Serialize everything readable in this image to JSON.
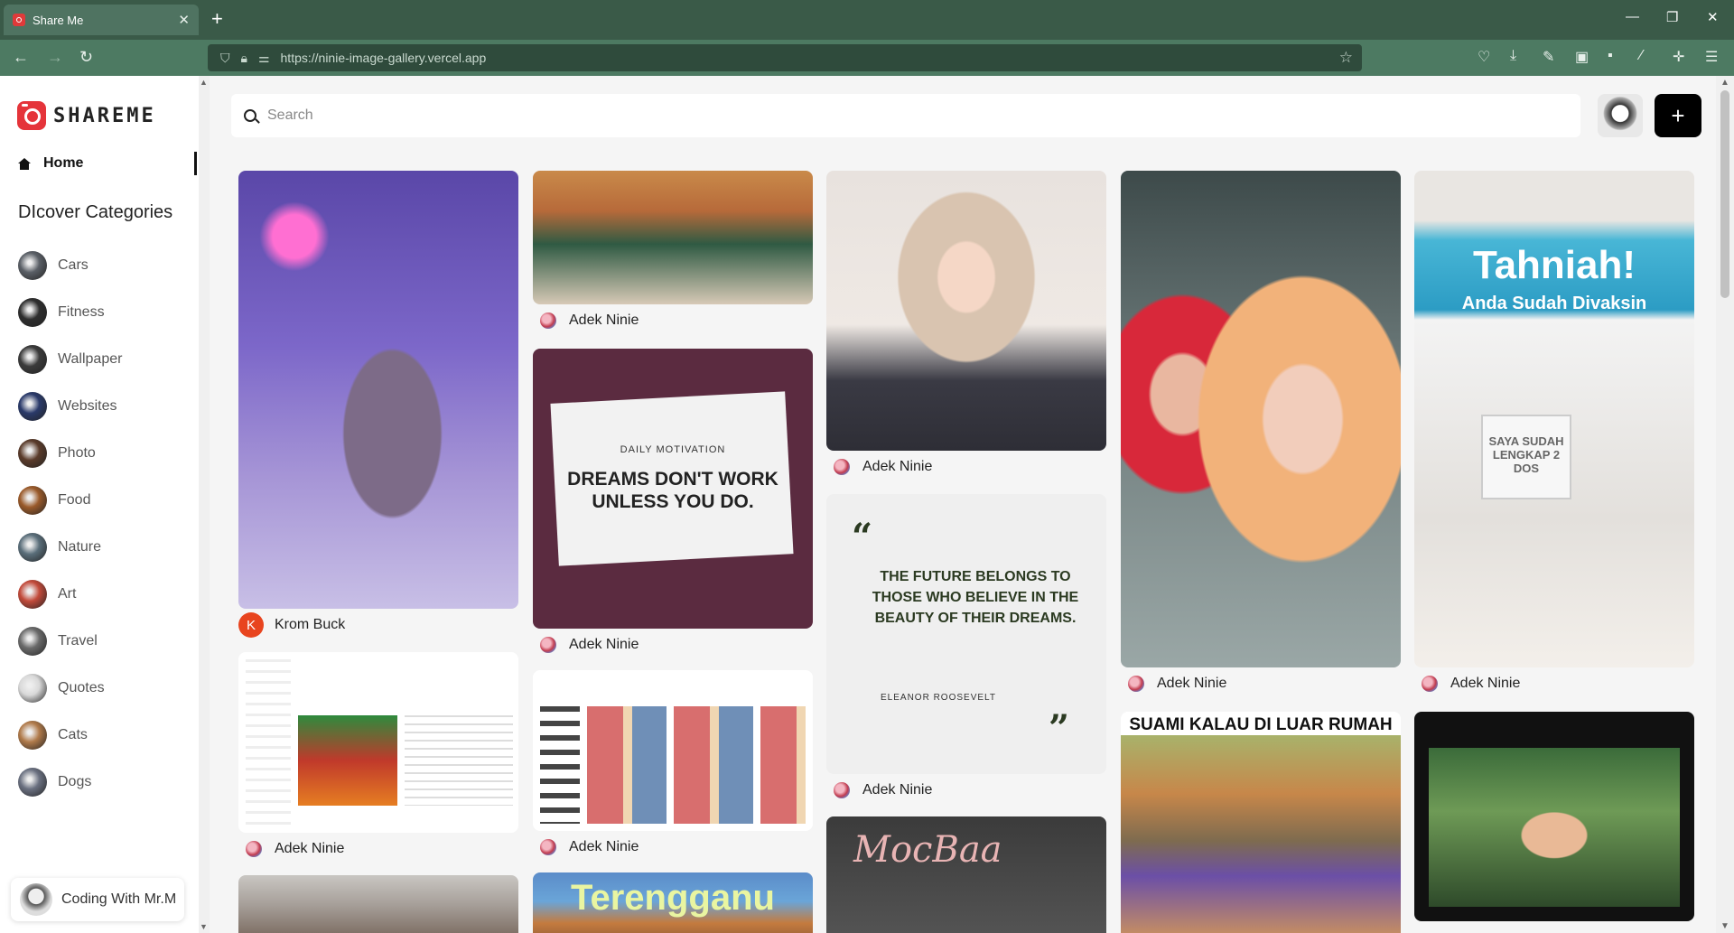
{
  "browser": {
    "tab_title": "Share Me",
    "url": "https://ninie-image-gallery.vercel.app"
  },
  "app": {
    "logo_text": "SHAREME",
    "home_label": "Home",
    "categories_title": "DIcover Categories",
    "categories": [
      {
        "name": "Cars",
        "color": "#5a5f66"
      },
      {
        "name": "Fitness",
        "color": "#2e2e2e"
      },
      {
        "name": "Wallpaper",
        "color": "#3a3a3a"
      },
      {
        "name": "Websites",
        "color": "#2a3a6a"
      },
      {
        "name": "Photo",
        "color": "#5a3b2a"
      },
      {
        "name": "Food",
        "color": "#9a5a2a"
      },
      {
        "name": "Nature",
        "color": "#5a6e7a"
      },
      {
        "name": "Art",
        "color": "#c24a3a"
      },
      {
        "name": "Travel",
        "color": "#6a6a6a"
      },
      {
        "name": "Quotes",
        "color": "#d9d9d9"
      },
      {
        "name": "Cats",
        "color": "#b07a4a"
      },
      {
        "name": "Dogs",
        "color": "#6a7080"
      }
    ],
    "profile_name": "Coding With Mr.M",
    "search_placeholder": "Search",
    "add_button": "+",
    "accent_color": "#e5343a"
  },
  "pins": [
    {
      "author": "Krom Buck",
      "avatar_letter": "K"
    },
    {
      "author": "Adek Ninie"
    },
    {
      "author": "Adek Ninie"
    },
    {
      "author": "Adek Ninie"
    },
    {
      "author": "Adek Ninie"
    },
    {
      "author": "Adek Ninie"
    },
    {
      "author": "Adek Ninie"
    },
    {
      "author": "Adek Ninie"
    },
    {
      "author": "Adek Ninie"
    }
  ],
  "pin_text": {
    "daily_motivation": "DAILY MOTIVATION",
    "dreams_quote": "DREAMS DON'T WORK UNLESS YOU DO.",
    "future_quote": "THE FUTURE BELONGS TO THOSE WHO BELIEVE IN THE BEAUTY OF THEIR DREAMS.",
    "future_author": "ELEANOR ROOSEVELT",
    "tahniah_title": "Tahniah!",
    "tahniah_sub": "Anda Sudah Divaksin",
    "saya_sudah": "SAYA SUDAH LENGKAP 2 DOS",
    "tiger_heading": "SUAMI KALAU DI LUAR RUMAH",
    "terengganu": "Terengganu",
    "mocbaa": "MocBaa"
  }
}
